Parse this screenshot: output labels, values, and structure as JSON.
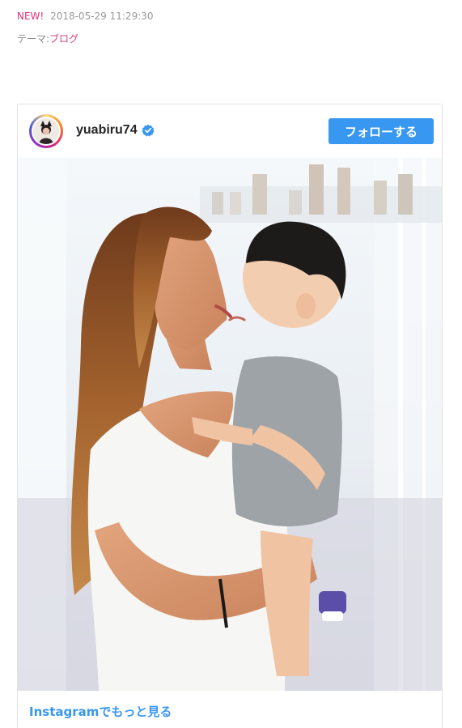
{
  "post_meta": {
    "new_badge": "NEW!",
    "timestamp": "2018-05-29 11:29:30",
    "theme_label": "テーマ:",
    "theme_link": "ブログ"
  },
  "instagram_embed": {
    "username": "yuabiru74",
    "verified": true,
    "follow_button_label": "フォローする",
    "more_link_label": "Instagramでもっと見る",
    "accent_color": "#3897f0",
    "photo_description_icon": "photo"
  }
}
